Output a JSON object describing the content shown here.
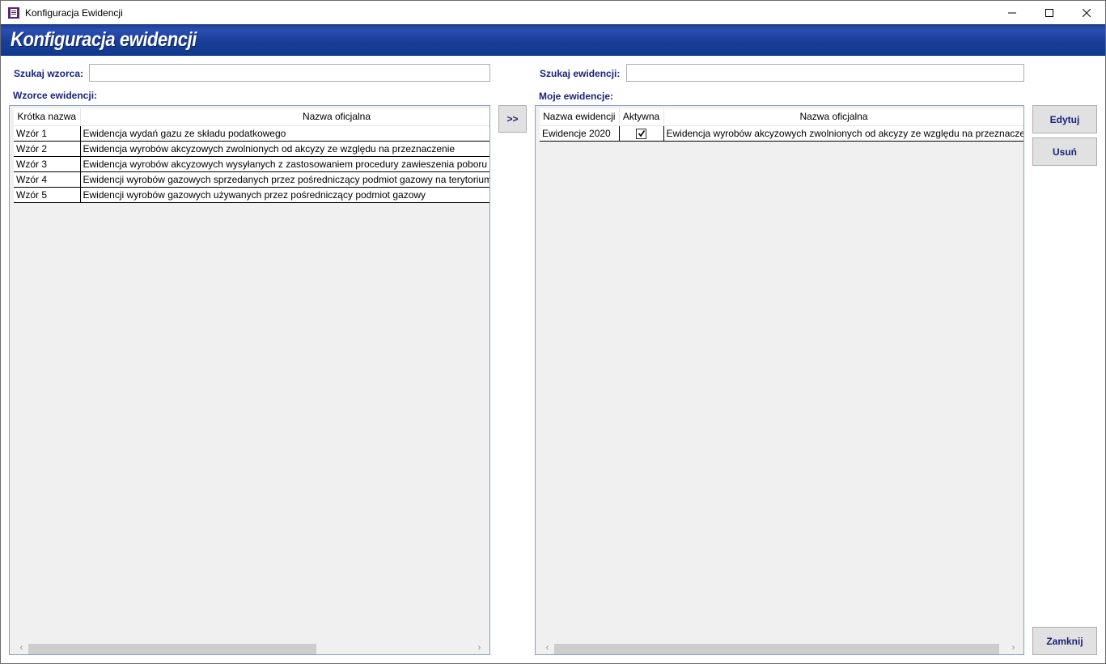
{
  "window": {
    "title": "Konfiguracja Ewidencji",
    "banner_title": "Konfiguracja ewidencji"
  },
  "left": {
    "search_label": "Szukaj wzorca:",
    "search_value": "",
    "list_label": "Wzorce ewidencji:",
    "columns": [
      "Krótka nazwa",
      "Nazwa oficjalna"
    ],
    "rows": [
      {
        "short": "Wzór 1",
        "name": "Ewidencja wydań gazu ze składu podatkowego"
      },
      {
        "short": "Wzór 2",
        "name": "Ewidencja wyrobów akcyzowych zwolnionych od akcyzy ze względu na przeznaczenie"
      },
      {
        "short": "Wzór 3",
        "name": "Ewidencja wyrobów akcyzowych wysyłanych z zastosowaniem procedury zawieszenia poboru akcyzy"
      },
      {
        "short": "Wzór 4",
        "name": "Ewidencji wyrobów gazowych sprzedanych przez pośredniczący podmiot gazowy na terytorium kraju"
      },
      {
        "short": "Wzór 5",
        "name": "Ewidencji wyrobów gazowych używanych przez pośredniczący podmiot gazowy"
      }
    ]
  },
  "transfer_button": ">>",
  "right": {
    "search_label": "Szukaj ewidencji:",
    "search_value": "",
    "list_label": "Moje ewidencje:",
    "columns": [
      "Nazwa ewidencji",
      "Aktywna",
      "Nazwa oficjalna"
    ],
    "rows": [
      {
        "name": "Ewidencje 2020",
        "active": true,
        "official": "Ewidencja wyrobów akcyzowych zwolnionych od akcyzy ze względu na przeznaczenie"
      }
    ]
  },
  "buttons": {
    "edit": "Edytuj",
    "delete": "Usuń",
    "close": "Zamknij"
  },
  "icons": {
    "app": "app-document-icon",
    "minimize": "minimize-icon",
    "maximize": "maximize-icon",
    "close": "close-icon",
    "scroll_left": "chevron-left-icon",
    "scroll_right": "chevron-right-icon",
    "check": "checkmark-icon"
  },
  "colors": {
    "banner": "#1a3d98",
    "label_text": "#1a237e",
    "grid_border": "#82a0c8"
  }
}
